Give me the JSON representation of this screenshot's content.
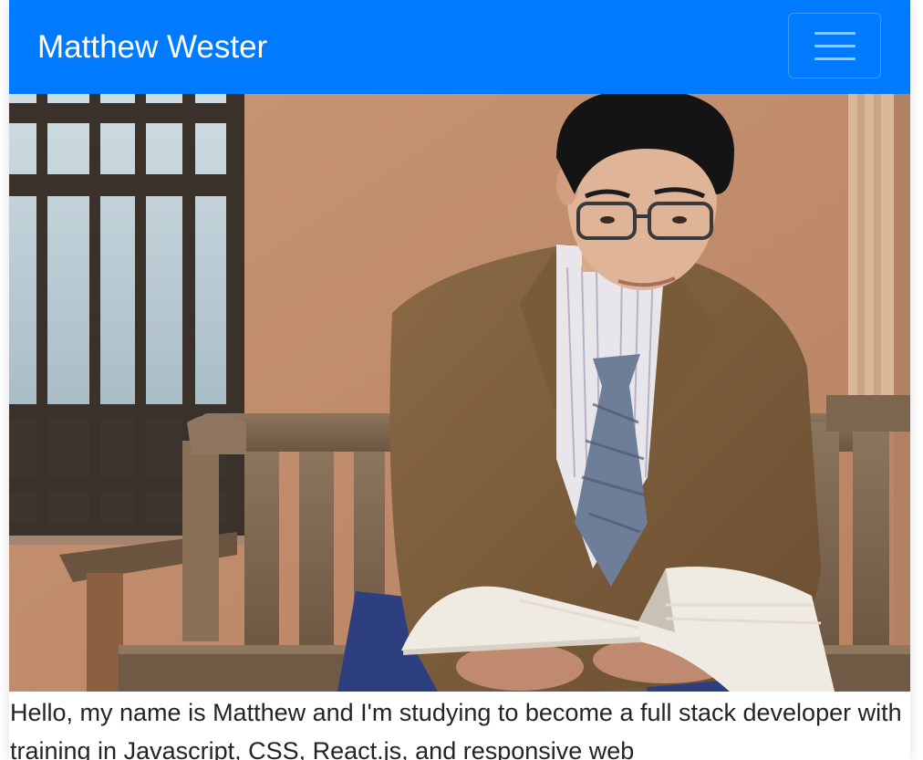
{
  "navbar": {
    "brand": "Matthew Wester",
    "menu_icon": "hamburger-menu-icon"
  },
  "hero": {
    "image": "portrait-photo"
  },
  "intro": {
    "text": "Hello, my name is Matthew and I'm studying to become a full stack developer with training in Javascript, CSS, React.js, and responsive web"
  },
  "colors": {
    "navbar_bg": "#007bff",
    "navbar_text": "#ffffff",
    "body_text": "#212529"
  }
}
